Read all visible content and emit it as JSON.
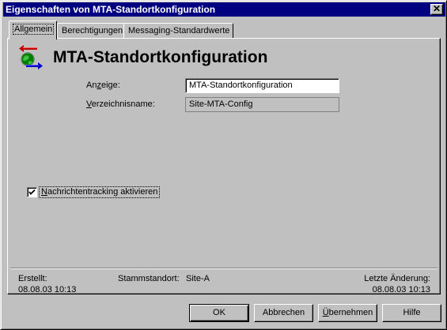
{
  "window": {
    "title": "Eigenschaften von MTA-Standortkonfiguration",
    "close_glyph": "✕"
  },
  "tabs": [
    {
      "label": "Allgemein",
      "active": true
    },
    {
      "label": "Berechtigungen",
      "active": false
    },
    {
      "label": "Messaging-Standardwerte",
      "active": false
    }
  ],
  "header": {
    "icon": "mta-config-icon",
    "title": "MTA-Standortkonfiguration"
  },
  "fields": {
    "display_label_pre": "An",
    "display_label_ul": "z",
    "display_label_post": "eige:",
    "display_value": "MTA-Standortkonfiguration",
    "dirname_label_ul": "V",
    "dirname_label_post": "erzeichnisname:",
    "dirname_value": "Site-MTA-Config"
  },
  "tracking": {
    "checked": true,
    "label_ul": "N",
    "label_post": "achrichtentracking aktivieren"
  },
  "footer_info": {
    "created_label": "Erstellt:",
    "created_value": "08.08.03  10:13",
    "home_site_label": "Stammstandort:",
    "home_site_value": "Site-A",
    "modified_label": "Letzte Änderung:",
    "modified_value": "08.08.03  10:13"
  },
  "buttons": {
    "ok": "OK",
    "cancel": "Abbrechen",
    "apply_ul": "Ü",
    "apply_post": "bernehmen",
    "help": "Hilfe"
  }
}
